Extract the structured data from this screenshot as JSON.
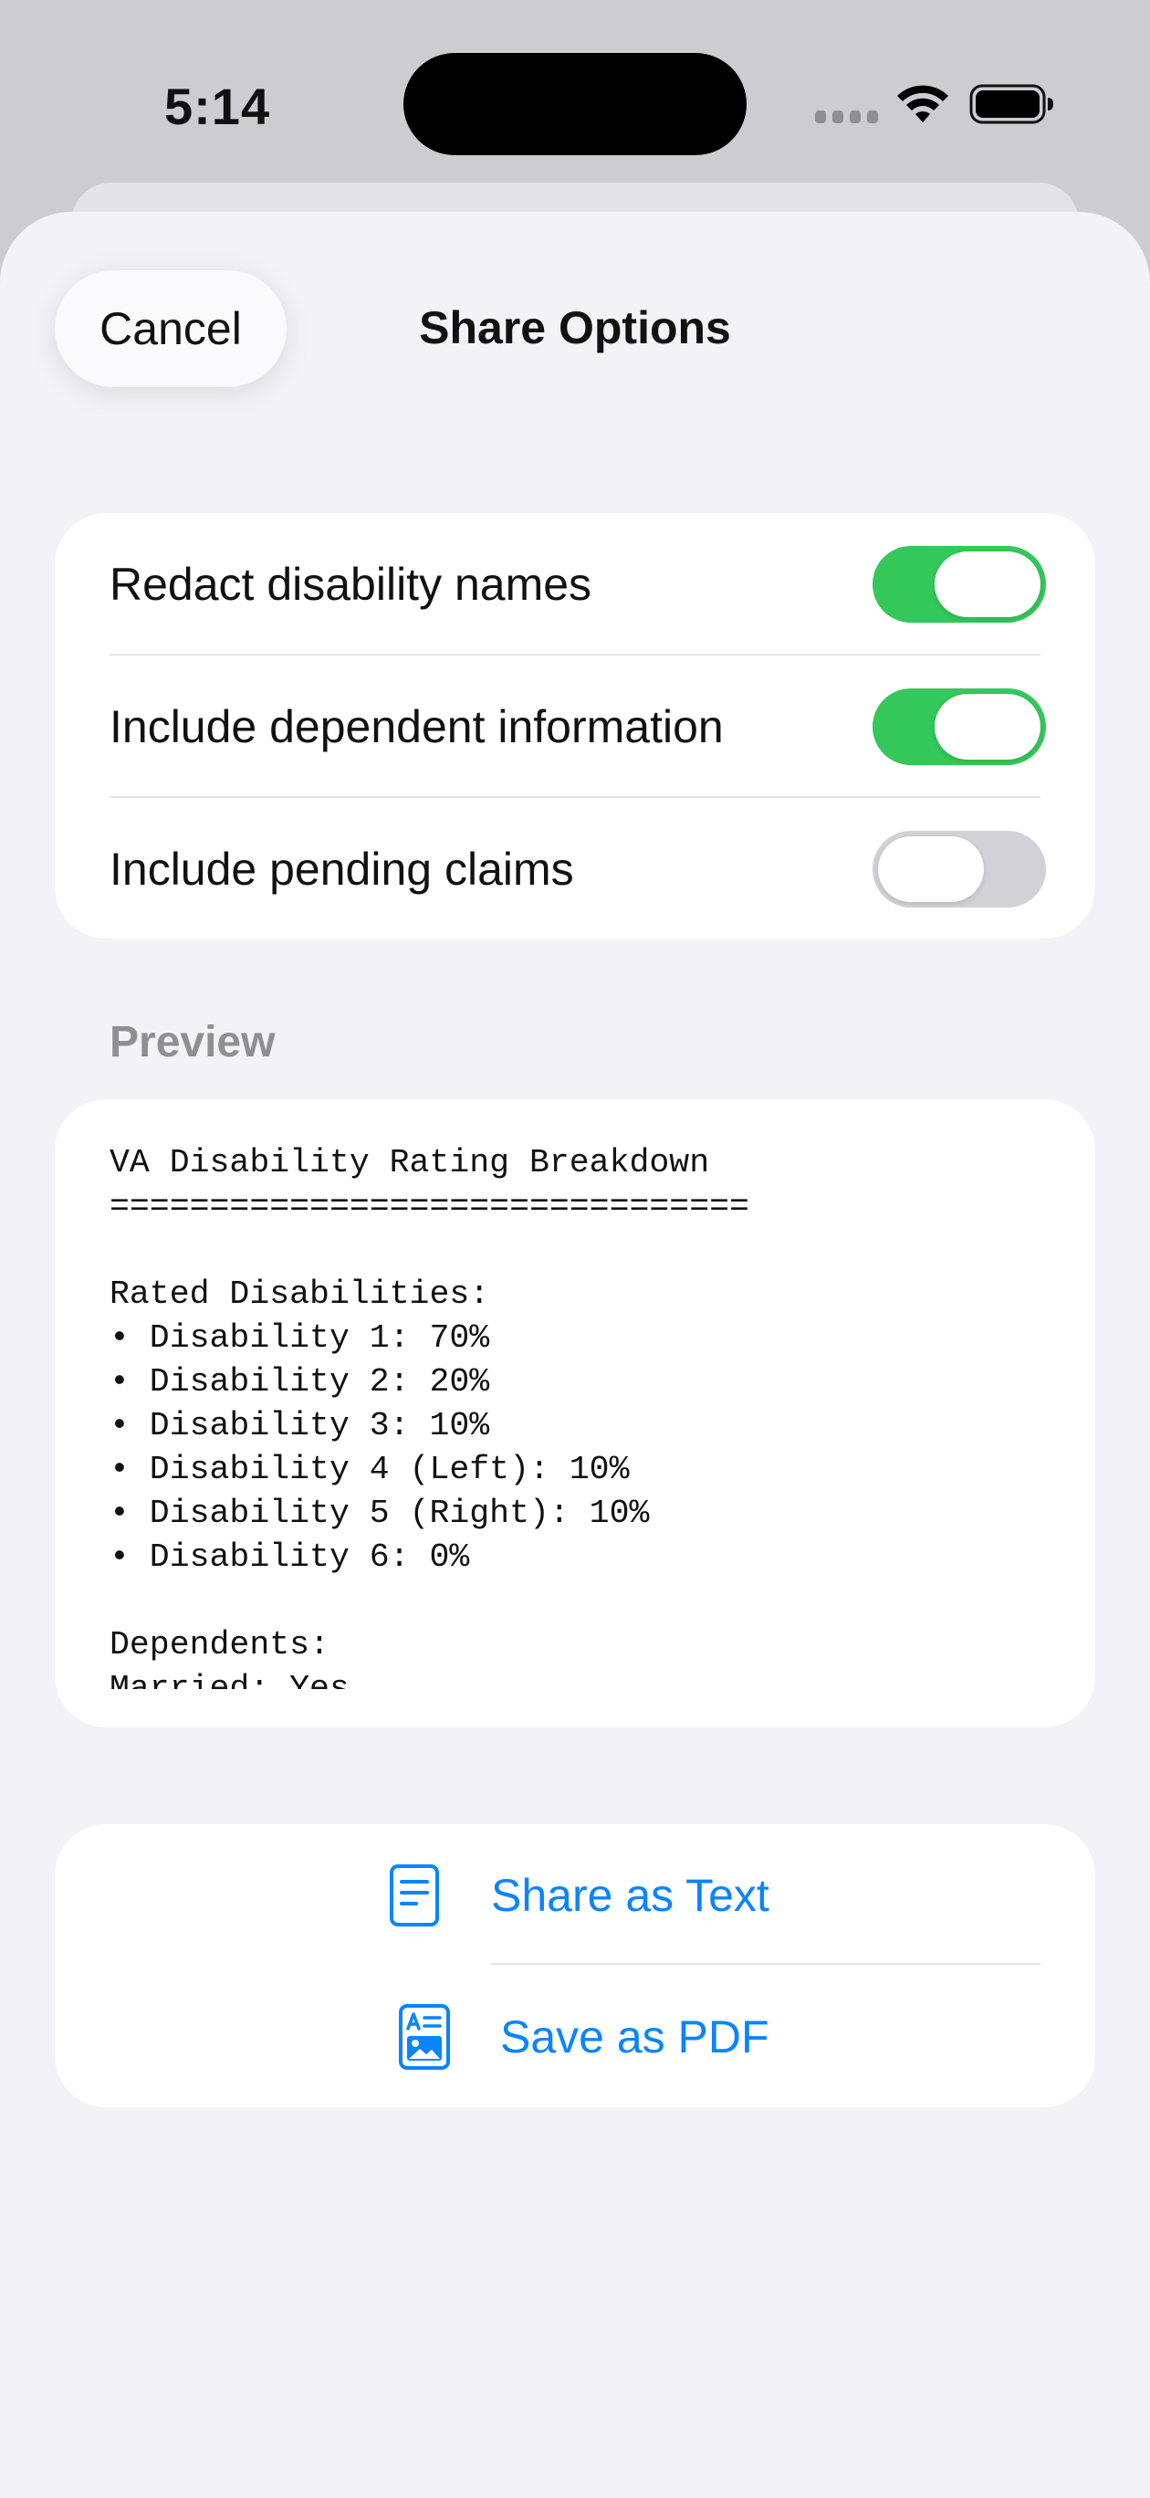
{
  "status_bar": {
    "time": "5:14"
  },
  "header": {
    "cancel_label": "Cancel",
    "title": "Share Options"
  },
  "options": [
    {
      "label": "Redact disability names",
      "on": true
    },
    {
      "label": "Include dependent information",
      "on": true
    },
    {
      "label": "Include pending claims",
      "on": false
    }
  ],
  "preview": {
    "header": "Preview",
    "lines": [
      "VA Disability Rating Breakdown",
      "================================",
      "",
      "Rated Disabilities:",
      "• Disability 1: 70%",
      "• Disability 2: 20%",
      "• Disability 3: 10%",
      "• Disability 4 (Left): 10%",
      "• Disability 5 (Right): 10%",
      "• Disability 6: 0%",
      "",
      "Dependents:",
      "Married: Yes"
    ]
  },
  "actions": {
    "share_text_label": "Share as Text",
    "save_pdf_label": "Save as PDF"
  },
  "colors": {
    "accent": "#0a84ff",
    "toggle_on": "#34c759",
    "toggle_off": "#d1d1d6",
    "sheet_background": "#f2f2f7"
  }
}
